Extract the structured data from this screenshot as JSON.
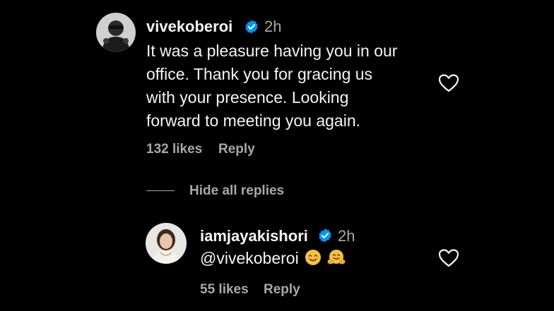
{
  "comment": {
    "username": "vivekoberoi",
    "time": "2h",
    "text_lines": [
      "It was a pleasure having you in our",
      "office. Thank you for gracing us",
      "with your presence. Looking",
      "forward to meeting you again."
    ],
    "likes": "132 likes",
    "reply_label": "Reply"
  },
  "replies_toggle": {
    "label": "Hide all replies"
  },
  "reply": {
    "username": "iamjayakishori",
    "time": "2h",
    "mention": "@vivekoberoi",
    "emojis": [
      "smiling-face-icon",
      "hugging-face-icon"
    ],
    "likes": "55 likes",
    "reply_label": "Reply"
  },
  "colors": {
    "background": "#000000",
    "text_primary": "#f5f5f5",
    "text_secondary": "#a8a8a8",
    "verified_blue": "#0095f6",
    "emoji_yellow": "#f7c23e"
  }
}
